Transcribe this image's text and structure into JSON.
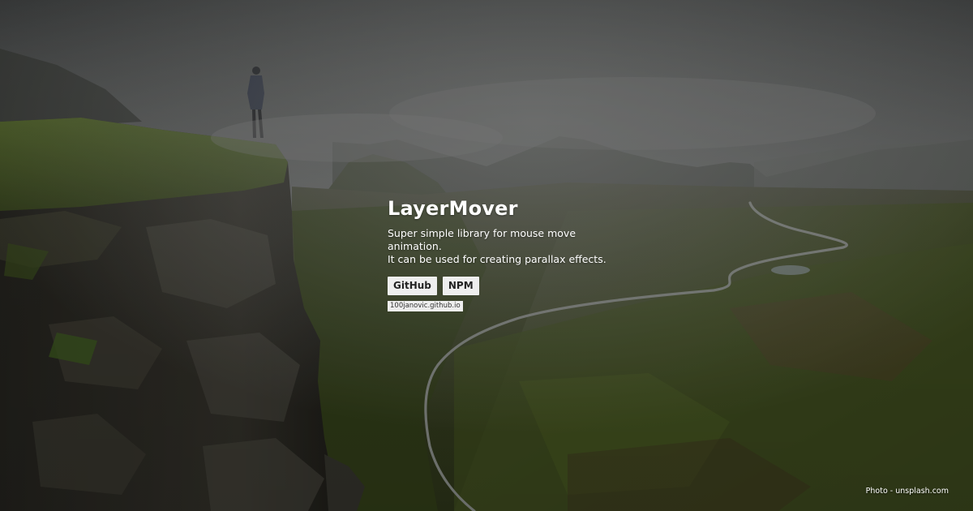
{
  "hero": {
    "title": "LayerMover",
    "description_line1": "Super simple library for mouse move animation.",
    "description_line2": "It can be used for creating parallax effects.",
    "buttons": [
      {
        "label": "GitHub"
      },
      {
        "label": "NPM"
      }
    ],
    "site_link": "100janovic.github.io"
  },
  "credit": "Photo - unsplash.com",
  "colors": {
    "sky": "#5c5f5f",
    "fog": "#8a8c8b",
    "valley_green": "#3c4a26",
    "cliff_rock": "#2b2a24",
    "button_bg": "#eeeeee",
    "text": "#ffffff"
  }
}
